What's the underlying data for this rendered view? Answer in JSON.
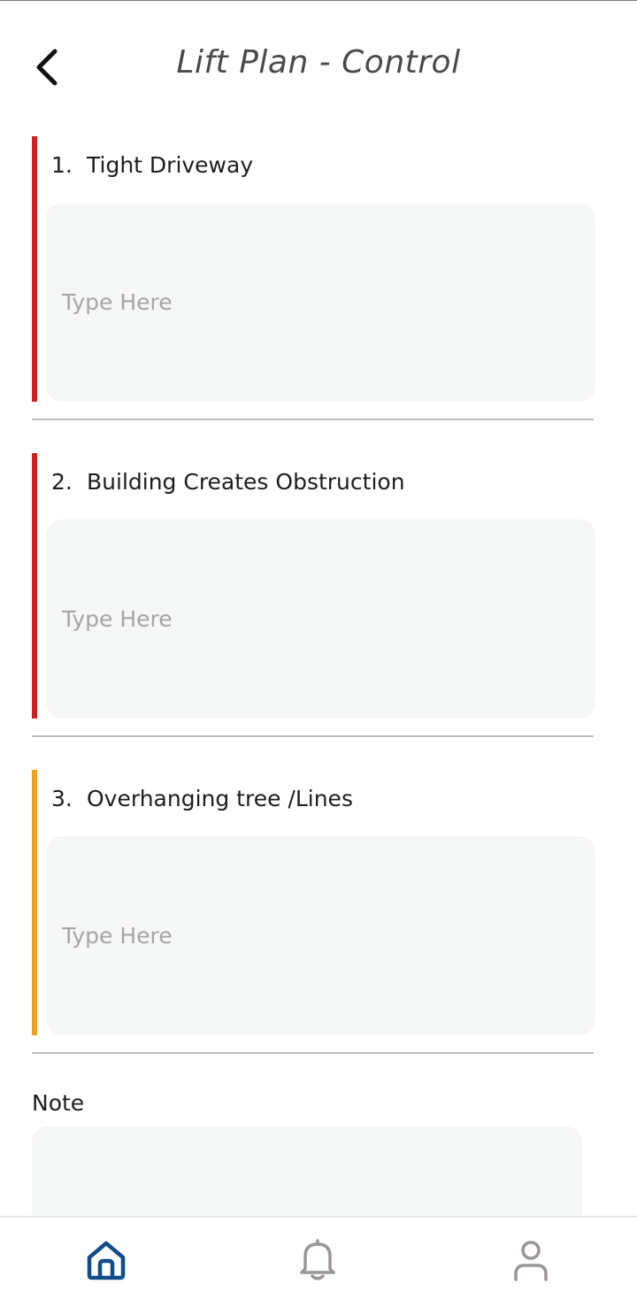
{
  "header": {
    "title": "Lift Plan - Control"
  },
  "colors": {
    "red_flag": "#d01f1f",
    "amber_flag": "#f0a01e",
    "nav_active": "#0e4c8a",
    "nav_inactive": "#9b9595"
  },
  "questions": [
    {
      "number": "1.",
      "label": "Tight Driveway",
      "placeholder": "Type Here",
      "flag": "red"
    },
    {
      "number": "2.",
      "label": "Building Creates Obstruction",
      "placeholder": "Type Here",
      "flag": "red"
    },
    {
      "number": "3.",
      "label": "Overhanging tree /Lines",
      "placeholder": "Type Here",
      "flag": "amber"
    }
  ],
  "note": {
    "label": "Note"
  },
  "nav": {
    "items": [
      {
        "icon": "home-icon",
        "active": true
      },
      {
        "icon": "bell-icon",
        "active": false
      },
      {
        "icon": "user-icon",
        "active": false
      }
    ]
  }
}
